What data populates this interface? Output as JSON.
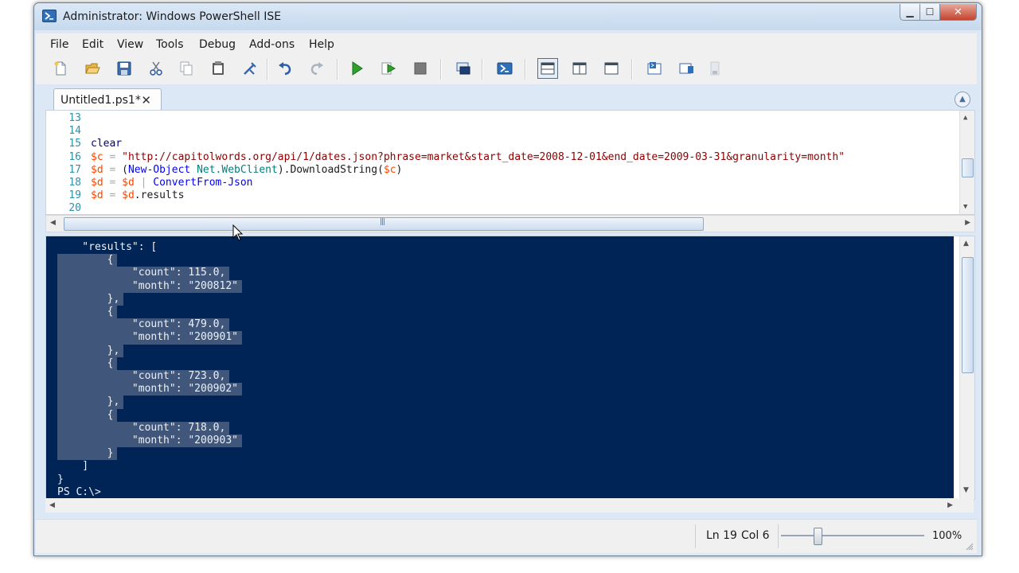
{
  "window": {
    "title": "Administrator: Windows PowerShell ISE"
  },
  "menu": [
    "File",
    "Edit",
    "View",
    "Tools",
    "Debug",
    "Add-ons",
    "Help"
  ],
  "toolbar": {
    "icons": [
      "new-file-icon",
      "open-folder-icon",
      "save-icon",
      "cut-icon",
      "copy-icon",
      "paste-icon",
      "clear-icon",
      "undo-icon",
      "redo-icon",
      "run-icon",
      "run-selection-icon",
      "stop-icon",
      "remote-tab-icon",
      "powershell-icon",
      "layout-top-icon",
      "layout-right-icon",
      "layout-max-icon",
      "show-script-icon",
      "show-console-icon"
    ]
  },
  "tab": {
    "label": "Untitled1.ps1*",
    "close": "✕"
  },
  "editor": {
    "lines": [
      {
        "num": "13",
        "tokens": []
      },
      {
        "num": "14",
        "tokens": []
      },
      {
        "num": "15",
        "tokens": [
          {
            "t": "clear",
            "c": "kw"
          }
        ]
      },
      {
        "num": "16",
        "tokens": [
          {
            "t": "$c",
            "c": "var"
          },
          {
            "t": " = ",
            "c": "op"
          },
          {
            "t": "\"http://capitolwords.org/api/1/dates.json?phrase=market&start_date=2008-12-01&end_date=2009-03-31&granularity=month\"",
            "c": "str"
          }
        ]
      },
      {
        "num": "17",
        "tokens": [
          {
            "t": "$d",
            "c": "var"
          },
          {
            "t": " = ",
            "c": "op"
          },
          {
            "t": "(",
            "c": ""
          },
          {
            "t": "New-Object",
            "c": "cmd"
          },
          {
            "t": " ",
            "c": ""
          },
          {
            "t": "Net.WebClient",
            "c": "typ"
          },
          {
            "t": ").",
            "c": ""
          },
          {
            "t": "DownloadString",
            "c": ""
          },
          {
            "t": "(",
            "c": ""
          },
          {
            "t": "$c",
            "c": "var"
          },
          {
            "t": ")",
            "c": ""
          }
        ]
      },
      {
        "num": "18",
        "tokens": [
          {
            "t": "$d",
            "c": "var"
          },
          {
            "t": " = ",
            "c": "op"
          },
          {
            "t": "$d",
            "c": "var"
          },
          {
            "t": " | ",
            "c": "op"
          },
          {
            "t": "ConvertFrom-Json",
            "c": "cmd"
          }
        ]
      },
      {
        "num": "19",
        "tokens": [
          {
            "t": "$d",
            "c": "var"
          },
          {
            "t": " = ",
            "c": "op"
          },
          {
            "t": "$d",
            "c": "var"
          },
          {
            "t": ".results",
            "c": ""
          }
        ]
      },
      {
        "num": "20",
        "tokens": []
      }
    ]
  },
  "console": {
    "lines": [
      "    \"results\": [",
      "        {",
      "            \"count\": 115.0,",
      "            \"month\": \"200812\"",
      "        },",
      "        {",
      "            \"count\": 479.0,",
      "            \"month\": \"200901\"",
      "        },",
      "        {",
      "            \"count\": 723.0,",
      "            \"month\": \"200902\"",
      "        },",
      "        {",
      "            \"count\": 718.0,",
      "            \"month\": \"200903\"",
      "        }",
      "    ]",
      "}",
      "PS C:\\>"
    ]
  },
  "status": {
    "ln": "Ln 19",
    "col": "Col 6",
    "zoom": "100%"
  }
}
